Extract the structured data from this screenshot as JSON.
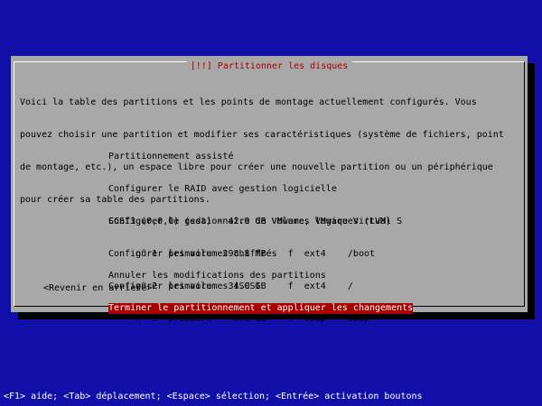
{
  "dialog": {
    "title": "[!!] Partitionner les disques",
    "intro_lines": [
      "Voici la table des partitions et les points de montage actuellement configurés. Vous",
      "pouvez choisir une partition et modifier ses caractéristiques (système de fichiers, point",
      "de montage, etc.), un espace libre pour créer une nouvelle partition ou un périphérique",
      "pour créer sa table des partitions."
    ],
    "menu": [
      "Partitionnement assisté",
      "Configurer le RAID avec gestion logicielle",
      "Configurer le gestionnaire de volumes logiques (LVM)",
      "Configurer les volumes chiffrés",
      "Configurer les volumes iSCSI"
    ],
    "disk": "SCSI3 (0,0,0) (sda) - 42.9 GB VMware, VMware Virtual S",
    "partitions": [
      "     n° 1  primaire  298.8 MB    f  ext4    /boot",
      "     n° 2  primaire   34.0 GB    f  ext4    /",
      "     n° 3  primaire    8.6 GB    f  swap    swap"
    ],
    "actions": [
      "Annuler les modifications des partitions",
      "Terminer le partitionnement et appliquer les changements"
    ],
    "back_label": "<Revenir en arrière>"
  },
  "statusbar": "<F1> aide; <Tab> déplacement; <Espace> sélection; <Entrée> activation boutons",
  "colors": {
    "background": "#1010a8",
    "dialog": "#a8a8a8",
    "title": "#a80000",
    "selection_bg": "#a80000",
    "selection_fg": "#ffffff"
  }
}
